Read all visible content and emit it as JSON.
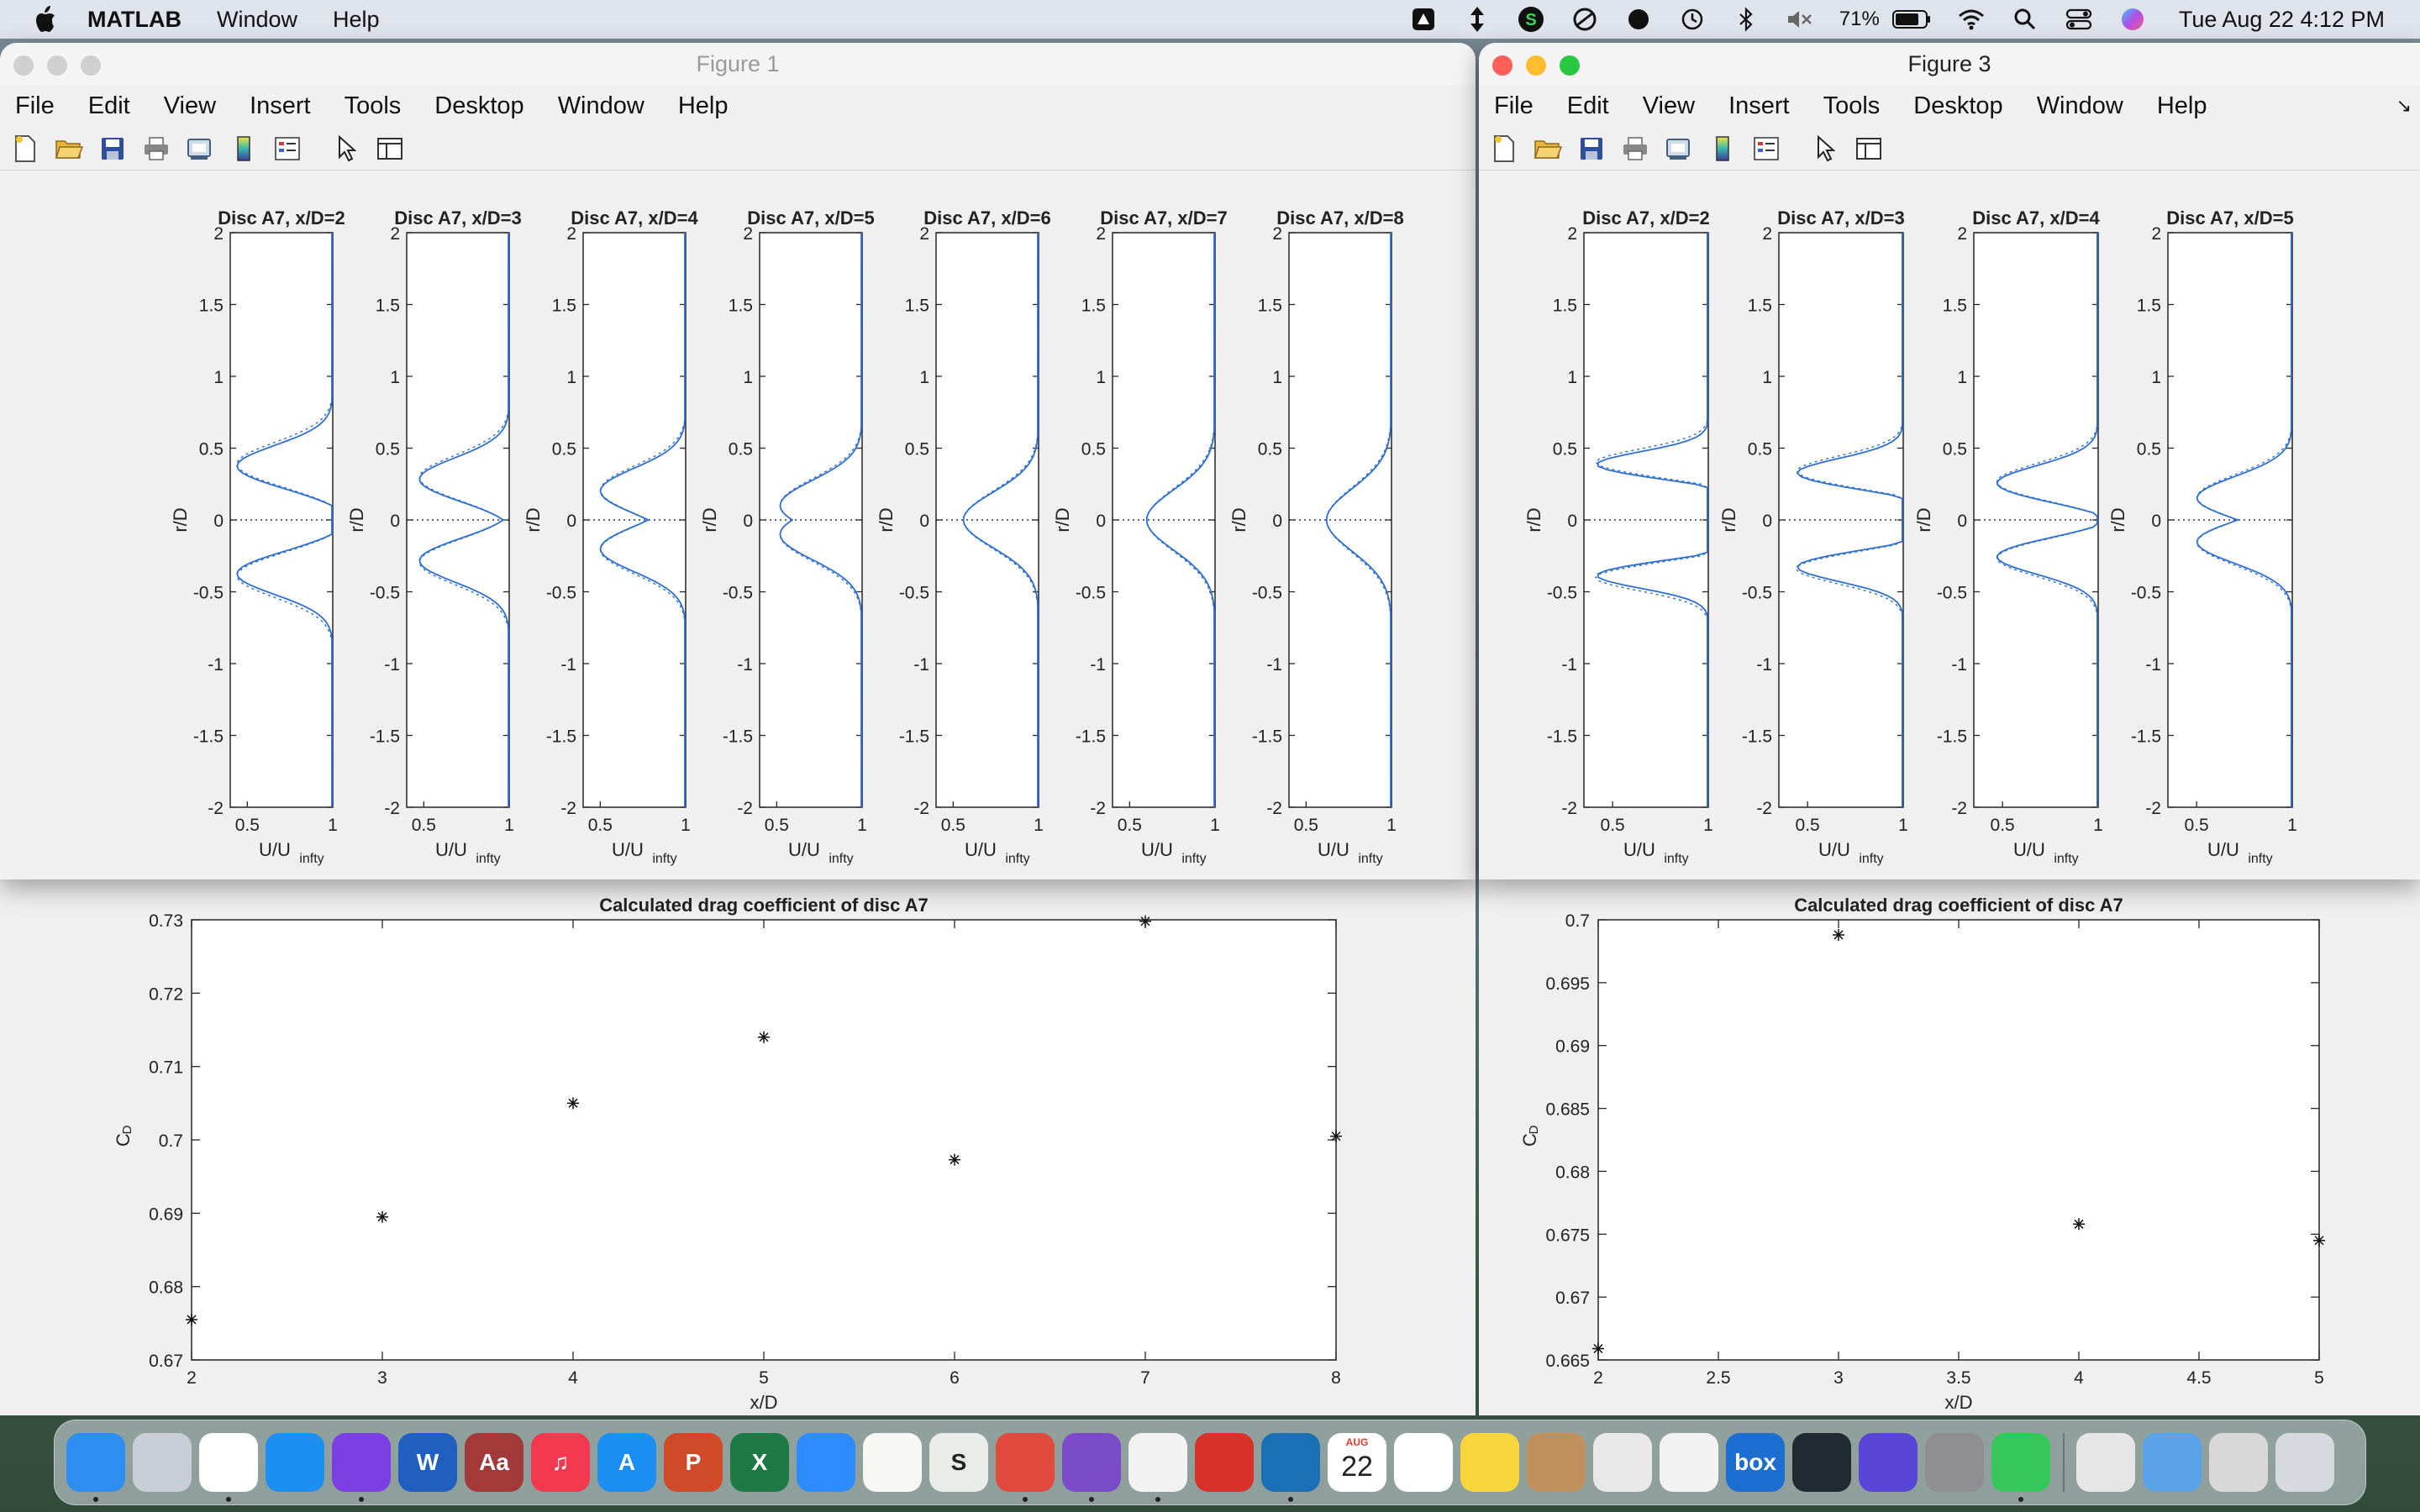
{
  "menubar": {
    "app_name": "MATLAB",
    "items": [
      "Window",
      "Help"
    ],
    "battery": "71%",
    "clock": "Tue Aug 22  4:12 PM",
    "status_icons": [
      "aws-icon",
      "scroll-arrows-icon",
      "green-s-icon",
      "half-circle-icon",
      "record-icon",
      "time-machine-icon",
      "bluetooth-icon",
      "mute-icon",
      "battery-icon",
      "wifi-icon",
      "search-icon",
      "control-center-icon",
      "siri-icon"
    ]
  },
  "figure1": {
    "title": "Figure 1",
    "menus": [
      "File",
      "Edit",
      "View",
      "Insert",
      "Tools",
      "Desktop",
      "Window",
      "Help"
    ],
    "toolbar": [
      "new-file-icon",
      "open-folder-icon",
      "save-icon",
      "print-icon",
      "print-preview-icon",
      "colorbar-icon",
      "legend-icon",
      "pointer-icon",
      "panel-icon"
    ]
  },
  "figure3": {
    "title": "Figure 3",
    "menus": [
      "File",
      "Edit",
      "View",
      "Insert",
      "Tools",
      "Desktop",
      "Window",
      "Help"
    ],
    "toolbar": [
      "new-file-icon",
      "open-folder-icon",
      "save-icon",
      "print-icon",
      "print-preview-icon",
      "colorbar-icon",
      "legend-icon",
      "pointer-icon",
      "panel-icon"
    ]
  },
  "chart_data": [
    {
      "type": "line",
      "figure": "Figure 1",
      "panels": [
        "Disc A7, x/D=2",
        "Disc A7, x/D=3",
        "Disc A7, x/D=4",
        "Disc A7, x/D=5",
        "Disc A7, x/D=6",
        "Disc A7, x/D=7",
        "Disc A7, x/D=8"
      ],
      "xlabel": "U/U",
      "xlabel_sub": "infty",
      "ylabel": "r/D",
      "xlim": [
        0.4,
        1.0
      ],
      "ylim": [
        -2,
        2
      ],
      "xticks": [
        "0.5",
        "1"
      ],
      "yticks": [
        "-2",
        "-1.5",
        "-1",
        "-0.5",
        "0",
        "0.5",
        "1",
        "1.5",
        "2"
      ],
      "profiles": [
        {
          "mins": [
            0.43,
            0.43
          ],
          "centre": 0.55,
          "ys": 0.37,
          "width": 0.35,
          "edge": 0.66
        },
        {
          "mins": [
            0.47,
            0.47
          ],
          "centre": 0.53,
          "ys": 0.28,
          "width": 0.36,
          "edge": 0.66
        },
        {
          "mins": [
            0.5,
            0.5
          ],
          "centre": 0.51,
          "ys": 0.2,
          "width": 0.38,
          "edge": 0.68
        },
        {
          "mins": [
            0.52,
            0.52
          ],
          "centre": 0.52,
          "ys": 0.1,
          "width": 0.42,
          "edge": 0.7
        },
        {
          "mins": [
            0.56,
            0.56
          ],
          "centre": 0.56,
          "ys": 0.0,
          "width": 0.46,
          "edge": 0.72
        },
        {
          "mins": [
            0.6,
            0.6
          ],
          "centre": 0.6,
          "ys": 0.0,
          "width": 0.5,
          "edge": 0.75
        },
        {
          "mins": [
            0.62,
            0.62
          ],
          "centre": 0.62,
          "ys": 0.0,
          "width": 0.52,
          "edge": 0.78
        }
      ]
    },
    {
      "type": "line",
      "figure": "Figure 3",
      "panels": [
        "Disc A7, x/D=2",
        "Disc A7, x/D=3",
        "Disc A7, x/D=4",
        "Disc A7, x/D=5"
      ],
      "xlabel": "U/U",
      "xlabel_sub": "infty",
      "ylabel": "r/D",
      "xlim": [
        0.35,
        1.0
      ],
      "ylim": [
        -2,
        2
      ],
      "xticks": [
        "0.5",
        "1"
      ],
      "yticks": [
        "-2",
        "-1.5",
        "-1",
        "-0.5",
        "0",
        "0.5",
        "1",
        "1.5",
        "2"
      ],
      "profiles": [
        {
          "mins": [
            0.38,
            0.38
          ],
          "centre": 0.85,
          "ys": 0.38,
          "width": 0.22,
          "edge": 0.7
        },
        {
          "mins": [
            0.42,
            0.42
          ],
          "centre": 0.75,
          "ys": 0.32,
          "width": 0.25,
          "edge": 0.68
        },
        {
          "mins": [
            0.46,
            0.46
          ],
          "centre": 0.6,
          "ys": 0.25,
          "width": 0.3,
          "edge": 0.68
        },
        {
          "mins": [
            0.5,
            0.5
          ],
          "centre": 0.52,
          "ys": 0.15,
          "width": 0.36,
          "edge": 0.7
        }
      ]
    },
    {
      "type": "scatter",
      "title": "Calculated drag coefficient of disc A7",
      "xlabel": "x/D",
      "ylabel": "C",
      "ylabel_sub": "D",
      "xlim": [
        2,
        8
      ],
      "ylim": [
        0.67,
        0.73
      ],
      "xticks": [
        "2",
        "3",
        "4",
        "5",
        "6",
        "7",
        "8"
      ],
      "yticks": [
        "0.67",
        "0.68",
        "0.69",
        "0.7",
        "0.71",
        "0.72",
        "0.73"
      ],
      "x": [
        2,
        3,
        4,
        5,
        6,
        7,
        8
      ],
      "y": [
        0.6755,
        0.6895,
        0.705,
        0.714,
        0.6973,
        0.7298,
        0.7005
      ]
    },
    {
      "type": "scatter",
      "title": "Calculated drag coefficient of disc A7",
      "xlabel": "x/D",
      "ylabel": "C",
      "ylabel_sub": "D",
      "xlim": [
        2,
        5
      ],
      "ylim": [
        0.665,
        0.7
      ],
      "xticks": [
        "2",
        "2.5",
        "3",
        "3.5",
        "4",
        "4.5",
        "5"
      ],
      "yticks": [
        "0.665",
        "0.67",
        "0.675",
        "0.68",
        "0.685",
        "0.69",
        "0.695",
        "0.7"
      ],
      "x": [
        2,
        3,
        4,
        5
      ],
      "y": [
        0.6659,
        0.6988,
        0.6758,
        0.6745
      ]
    }
  ],
  "dock": {
    "apps": [
      {
        "name": "finder",
        "color": "#2b8ef0",
        "label": "",
        "running": true
      },
      {
        "name": "launchpad",
        "color": "#c9ced6",
        "label": "",
        "running": false
      },
      {
        "name": "chrome",
        "color": "#ffffff",
        "label": "",
        "running": true
      },
      {
        "name": "safari",
        "color": "#1d8ff2",
        "label": "",
        "running": false
      },
      {
        "name": "firefox",
        "color": "#7b3fe4",
        "label": "",
        "running": true
      },
      {
        "name": "word",
        "color": "#1f5fbf",
        "label": "W",
        "running": false
      },
      {
        "name": "dictionary",
        "color": "#a33a3a",
        "label": "Aa",
        "running": false
      },
      {
        "name": "music",
        "color": "#f2394f",
        "label": "♫",
        "running": false
      },
      {
        "name": "app-store",
        "color": "#1c8ff5",
        "label": "A",
        "running": false
      },
      {
        "name": "powerpoint",
        "color": "#d04a27",
        "label": "P",
        "running": false
      },
      {
        "name": "excel",
        "color": "#1e7a45",
        "label": "X",
        "running": false
      },
      {
        "name": "zoom",
        "color": "#2d8cff",
        "label": "",
        "running": false
      },
      {
        "name": "textedit",
        "color": "#f7f7f4",
        "label": "",
        "running": false
      },
      {
        "name": "scrivener",
        "color": "#e9ece8",
        "label": "S",
        "running": false
      },
      {
        "name": "remote-desktop",
        "color": "#e04a3c",
        "label": "",
        "running": true
      },
      {
        "name": "github-desktop",
        "color": "#7c4bc9",
        "label": "",
        "running": true
      },
      {
        "name": "matlab",
        "color": "#f2f2f2",
        "label": "",
        "running": true
      },
      {
        "name": "wolfram",
        "color": "#d9322b",
        "label": "",
        "running": false
      },
      {
        "name": "kindle",
        "color": "#1b6fb5",
        "label": "",
        "running": true
      },
      {
        "name": "calendar",
        "color": "#ffffff",
        "label": "22",
        "running": false
      },
      {
        "name": "reminders",
        "color": "#ffffff",
        "label": "",
        "running": false
      },
      {
        "name": "notes",
        "color": "#f7d53b",
        "label": "",
        "running": false
      },
      {
        "name": "contacts",
        "color": "#c0905c",
        "label": "",
        "running": false
      },
      {
        "name": "screenshot",
        "color": "#e8e8e8",
        "label": "",
        "running": false
      },
      {
        "name": "pages",
        "color": "#f2f2f2",
        "label": "",
        "running": false
      },
      {
        "name": "box",
        "color": "#1c6fd1",
        "label": "box",
        "running": false
      },
      {
        "name": "activity-monitor",
        "color": "#1f2a33",
        "label": "",
        "running": false
      },
      {
        "name": "shortcuts",
        "color": "#5a46d6",
        "label": "",
        "running": false
      },
      {
        "name": "system-settings",
        "color": "#8e8e93",
        "label": "",
        "running": false
      },
      {
        "name": "messages",
        "color": "#35c759",
        "label": "",
        "running": true
      }
    ],
    "right_apps": [
      {
        "name": "documents-stack",
        "color": "#e6e6e6"
      },
      {
        "name": "downloads-folder",
        "color": "#5aa3e8"
      },
      {
        "name": "screenshots-stack",
        "color": "#d8d8d8"
      },
      {
        "name": "trash",
        "color": "#d6d9de"
      }
    ],
    "calendar_month": "AUG"
  }
}
